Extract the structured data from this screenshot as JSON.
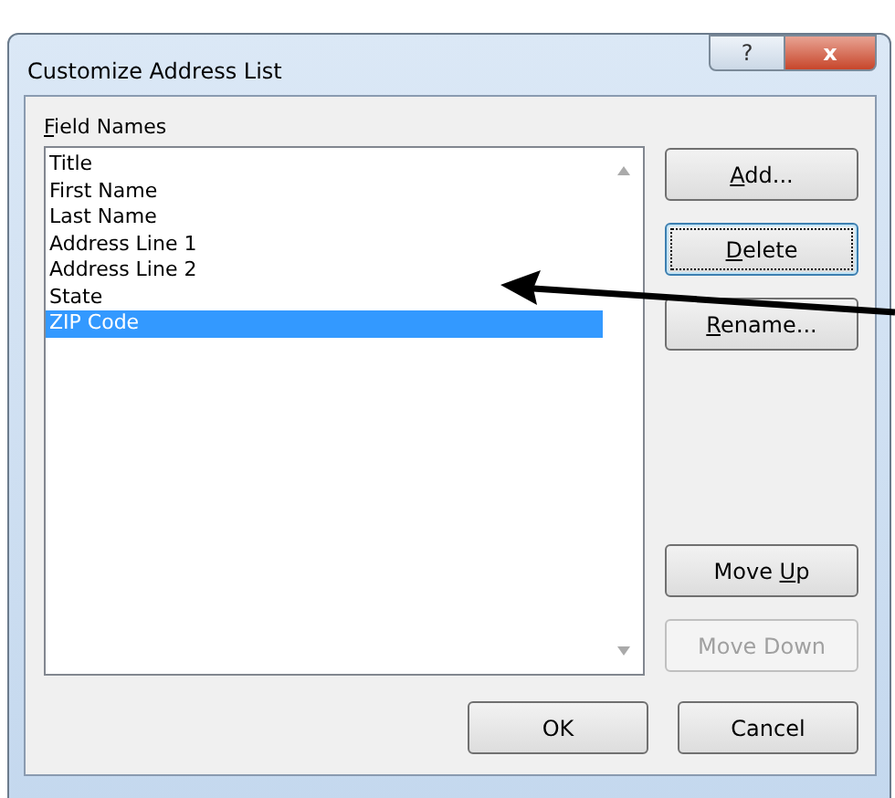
{
  "window": {
    "title": "Customize Address List",
    "help_glyph": "?",
    "close_glyph": "x"
  },
  "field_names": {
    "label": {
      "key": "F",
      "after": "ield Names"
    },
    "items": [
      {
        "text": "Title",
        "selected": false
      },
      {
        "text": "First Name",
        "selected": false
      },
      {
        "text": "Last Name",
        "selected": false
      },
      {
        "text": "Address Line 1",
        "selected": false
      },
      {
        "text": "Address Line 2",
        "selected": false
      },
      {
        "text": "State",
        "selected": false
      },
      {
        "text": "ZIP Code",
        "selected": true
      }
    ]
  },
  "side_buttons": [
    {
      "key": "A",
      "after": "dd...",
      "focused": false,
      "disabled": false
    },
    {
      "key": "D",
      "after": "elete",
      "focused": true,
      "disabled": false
    },
    {
      "key": "R",
      "after": "ename...",
      "focused": false,
      "disabled": false
    }
  ],
  "move_buttons": [
    {
      "before": "Move ",
      "key": "U",
      "after": "p",
      "focused": false,
      "disabled": false
    },
    {
      "after": "Move Down",
      "focused": false,
      "disabled": true
    }
  ],
  "footer_buttons": [
    "OK",
    "Cancel"
  ],
  "callout": {
    "kind": "arrow"
  }
}
